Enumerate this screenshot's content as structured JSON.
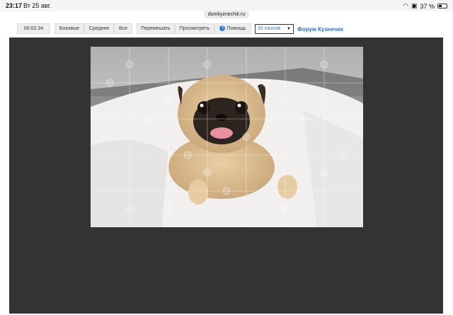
{
  "status": {
    "time": "23:17",
    "date": "Вт 25 авг.",
    "battery": "37 %"
  },
  "browser": {
    "url": "domkyznechik.ru"
  },
  "toolbar": {
    "timer": "00:02:34",
    "sides": "Боковые",
    "middle": "Средние",
    "all": "Все",
    "shuffle": "Перемешать",
    "preview": "Просмотреть",
    "help": "Помощь",
    "pieces_selected": "35 пазлов",
    "forum": "Форум Кузнечик"
  },
  "puzzle": {
    "cols": 7,
    "rows": 5,
    "subject": "pug under white blanket"
  }
}
